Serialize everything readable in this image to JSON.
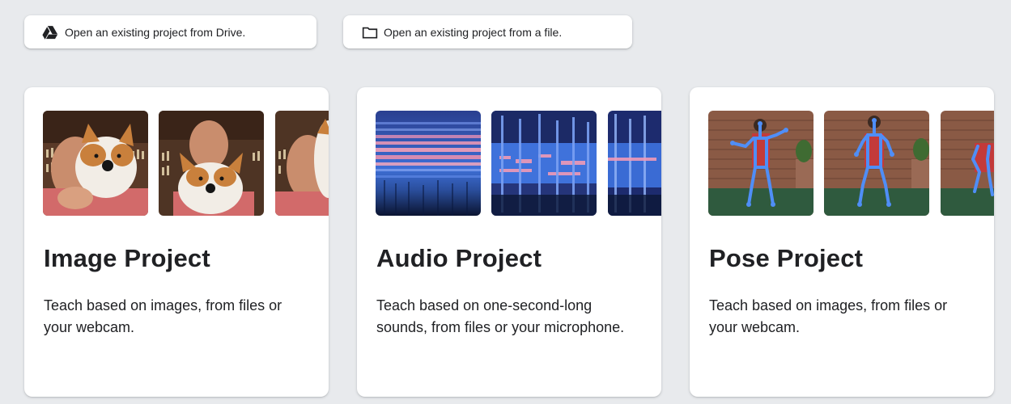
{
  "toolbar": {
    "drive_button": {
      "label": "Open an existing project from Drive.",
      "icon": "google-drive-icon"
    },
    "file_button": {
      "label": "Open an existing project from a file.",
      "icon": "folder-icon"
    }
  },
  "cards": [
    {
      "title": "Image Project",
      "description": "Teach based on images, from files or your webcam.",
      "thumbnails": [
        "webcam-plush-dog-photo",
        "webcam-plush-dog-photo",
        "webcam-plush-dog-photo"
      ]
    },
    {
      "title": "Audio Project",
      "description": "Teach based on one-second-long sounds, from files or your microphone.",
      "thumbnails": [
        "spectrogram",
        "spectrogram",
        "spectrogram"
      ]
    },
    {
      "title": "Pose Project",
      "description": "Teach based on images, from files or your webcam.",
      "thumbnails": [
        "pose-skeleton-photo",
        "pose-skeleton-photo",
        "pose-skeleton-photo"
      ]
    }
  ],
  "colors": {
    "page_background": "#e8eaed",
    "card_background": "#ffffff",
    "text": "#202124",
    "pose_skeleton": "#4f8ef7"
  }
}
